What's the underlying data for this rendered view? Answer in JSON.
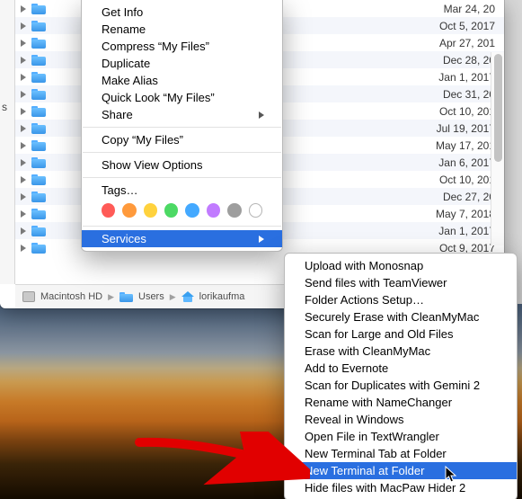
{
  "window": {
    "sidebar_stub_letter": "s",
    "scrollbar_name": "finder-scrollbar"
  },
  "files": [
    {
      "date": "Mar 24, 20"
    },
    {
      "date": "Oct 5, 2017"
    },
    {
      "date": "Apr 27, 201"
    },
    {
      "date": "Dec 28, 20"
    },
    {
      "date": "Jan 1, 2017"
    },
    {
      "date": "Dec 31, 20"
    },
    {
      "date": "Oct 10, 201"
    },
    {
      "date": "Jul 19, 2017"
    },
    {
      "date": "May 17, 201"
    },
    {
      "date": "Jan 6, 2017"
    },
    {
      "date": "Oct 10, 201"
    },
    {
      "date": "Dec 27, 20"
    },
    {
      "date": "May 7, 2018"
    },
    {
      "date": "Jan 1, 2017"
    },
    {
      "date": "Oct 9, 2017"
    }
  ],
  "pathbar": {
    "seg1": "Macintosh HD",
    "seg2": "Users",
    "seg3": "lorikaufma"
  },
  "ctx1_items": [
    {
      "t": "item",
      "label": "Get Info",
      "name": "ctx-get-info"
    },
    {
      "t": "item",
      "label": "Rename",
      "name": "ctx-rename"
    },
    {
      "t": "item",
      "label": "Compress “My Files”",
      "name": "ctx-compress"
    },
    {
      "t": "item",
      "label": "Duplicate",
      "name": "ctx-duplicate"
    },
    {
      "t": "item",
      "label": "Make Alias",
      "name": "ctx-make-alias"
    },
    {
      "t": "item",
      "label": "Quick Look “My Files”",
      "name": "ctx-quick-look"
    },
    {
      "t": "sub",
      "label": "Share",
      "name": "ctx-share"
    },
    {
      "t": "sep"
    },
    {
      "t": "item",
      "label": "Copy “My Files”",
      "name": "ctx-copy"
    },
    {
      "t": "sep"
    },
    {
      "t": "item",
      "label": "Show View Options",
      "name": "ctx-view-options"
    },
    {
      "t": "sep"
    },
    {
      "t": "item",
      "label": "Tags…",
      "name": "ctx-tags"
    },
    {
      "t": "tags"
    },
    {
      "t": "sep"
    },
    {
      "t": "sub-hl",
      "label": "Services",
      "name": "ctx-services"
    }
  ],
  "tag_colors": [
    "#ff5b57",
    "#ff9a3c",
    "#ffd23d",
    "#4cd964",
    "#44a9ff",
    "#c17bff",
    "#9e9e9e"
  ],
  "ctx2_items": [
    {
      "t": "item",
      "label": "Upload with Monosnap",
      "name": "svc-monosnap"
    },
    {
      "t": "item",
      "label": "Send files with TeamViewer",
      "name": "svc-teamviewer"
    },
    {
      "t": "item",
      "label": "Folder Actions Setup…",
      "name": "svc-folder-actions"
    },
    {
      "t": "item",
      "label": "Securely Erase with CleanMyMac",
      "name": "svc-erase-cleanmymac"
    },
    {
      "t": "item",
      "label": "Scan for Large and Old Files",
      "name": "svc-scan-large"
    },
    {
      "t": "item",
      "label": "Erase with CleanMyMac",
      "name": "svc-erase"
    },
    {
      "t": "item",
      "label": "Add to Evernote",
      "name": "svc-evernote"
    },
    {
      "t": "item",
      "label": "Scan for Duplicates with Gemini 2",
      "name": "svc-gemini"
    },
    {
      "t": "item",
      "label": "Rename with NameChanger",
      "name": "svc-namechanger"
    },
    {
      "t": "item",
      "label": "Reveal in Windows",
      "name": "svc-reveal-windows"
    },
    {
      "t": "item",
      "label": "Open File in TextWrangler",
      "name": "svc-textwrangler"
    },
    {
      "t": "item",
      "label": "New Terminal Tab at Folder",
      "name": "svc-terminal-tab"
    },
    {
      "t": "hl",
      "label": "New Terminal at Folder",
      "name": "svc-terminal-folder"
    },
    {
      "t": "item",
      "label": "Hide files with MacPaw Hider 2",
      "name": "svc-hider"
    }
  ]
}
